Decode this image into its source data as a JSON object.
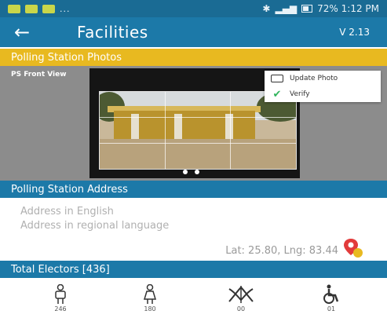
{
  "status_bar": {
    "dots": "...",
    "right_text": "72% 1:12 PM"
  },
  "app_bar": {
    "title": "Facilities",
    "version": "V 2.13"
  },
  "photos_section": {
    "header": "Polling Station Photos",
    "photo_label": "PS Front View",
    "menu": [
      {
        "label": "Update Photo",
        "icon": "photo-icon"
      },
      {
        "label": "Verify",
        "icon": "check-icon"
      }
    ]
  },
  "address_section": {
    "header": "Polling Station Address",
    "address_english": "Address in English",
    "address_regional": "Address in regional language",
    "latlng": "Lat: 25.80, Lng: 83.44"
  },
  "electors_section": {
    "header": "Total Electors [436]",
    "stats": [
      {
        "icon": "male-icon",
        "value": "246"
      },
      {
        "icon": "female-icon",
        "value": "180"
      },
      {
        "icon": "third-gender-icon",
        "value": "00"
      },
      {
        "icon": "wheelchair-icon",
        "value": "01"
      }
    ]
  },
  "colors": {
    "primary": "#1c79a8",
    "accent": "#e8b920",
    "pin": "#e23b3b"
  }
}
